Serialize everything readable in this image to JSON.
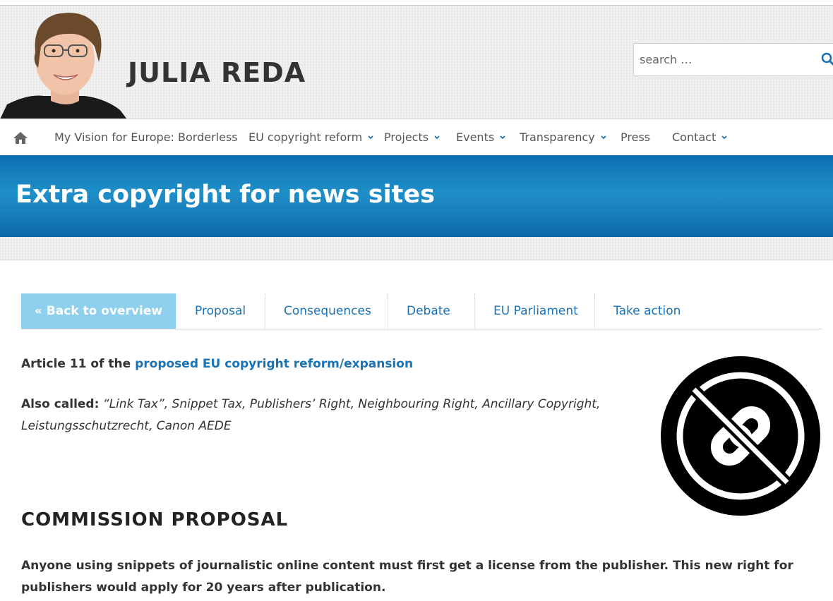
{
  "header": {
    "site_title": "JULIA REDA",
    "search_placeholder": "search …"
  },
  "nav": {
    "items": [
      {
        "label": "My Vision for Europe: Borderless",
        "dropdown": false
      },
      {
        "label": "EU copyright reform",
        "dropdown": true
      },
      {
        "label": "Projects",
        "dropdown": true
      },
      {
        "label": "Events",
        "dropdown": true
      },
      {
        "label": "Transparency",
        "dropdown": true
      },
      {
        "label": "Press",
        "dropdown": false
      },
      {
        "label": "Contact",
        "dropdown": true
      }
    ]
  },
  "banner": {
    "title": "Extra copyright for news sites"
  },
  "tabs": {
    "back_label": "« Back to overview",
    "items": [
      "Proposal",
      "Consequences",
      "Debate",
      "EU Parliament",
      "Take action"
    ]
  },
  "content": {
    "article_prefix": "Article 11 of the ",
    "article_link": "proposed EU copyright reform/expansion",
    "also_called_label": "Also called:",
    "also_called_line1": " “Link Tax”, Snippet Tax, Publishers’ Right, Neighbouring Right, Ancillary Copyright,",
    "also_called_line2": "Leistungsschutzrecht, Canon AEDE",
    "section_heading": "COMMISSION PROPOSAL",
    "paragraph": "Anyone using snippets of journalistic online content must first get a license from the publisher. This new right for publishers would apply for 20 years after publication."
  },
  "colors": {
    "accent_link": "#1a73b5",
    "banner_blue": "#1c86c2",
    "tab_active_bg": "#8ecfee"
  }
}
